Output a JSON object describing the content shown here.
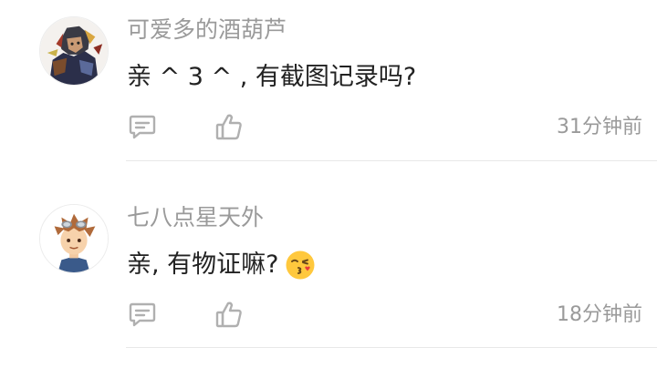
{
  "comments": [
    {
      "username": "可爱多的酒葫芦",
      "content": "亲 ^ 3 ^ , 有截图记录吗?",
      "time": "31分钟前",
      "avatar_icon": "anime-warrior-avatar",
      "emoji": null
    },
    {
      "username": "七八点星天外",
      "content": "亲, 有物证嘛?",
      "time": "18分钟前",
      "avatar_icon": "anime-boy-goggles-avatar",
      "emoji": "kissing-face-icon"
    }
  ],
  "colors": {
    "username": "#9a9a9a",
    "text": "#222222",
    "icon": "#b0b0b0",
    "divider": "#e8e8e8",
    "emoji": "#ffc83d"
  }
}
